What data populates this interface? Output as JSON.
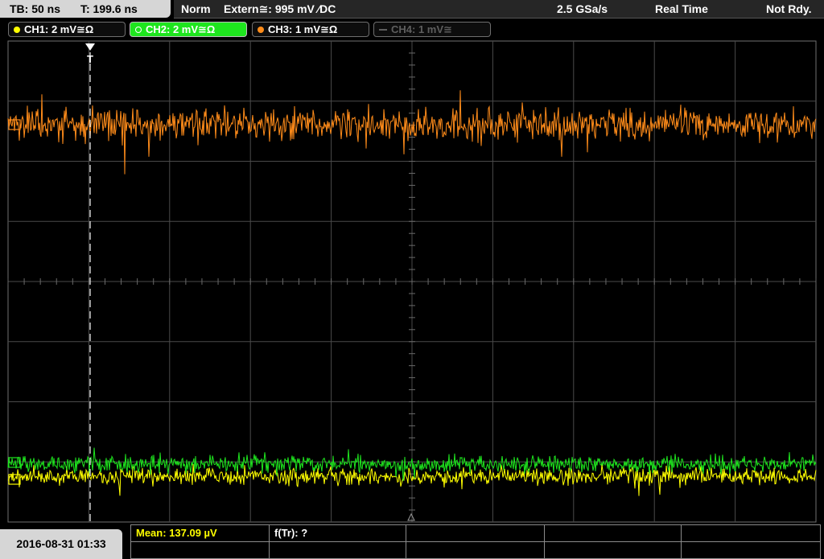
{
  "timebase": {
    "tb": "TB: 50 ns",
    "trigger_time": "T: 199.6 ns"
  },
  "status": {
    "mode": "Norm",
    "trigger": "Extern≅: 995 mV ∕DC",
    "sample_rate": "2.5 GSa/s",
    "acq_mode": "Real Time",
    "ready": "Not Rdy."
  },
  "channels": [
    {
      "label": "CH1: 2 mV≅Ω",
      "color": "#ffff00",
      "state": "on"
    },
    {
      "label": "CH2: 2 mV≅Ω",
      "color": "#1ee51e",
      "state": "active"
    },
    {
      "label": "CH3: 1 mV≅Ω",
      "color": "#ff8c1a",
      "state": "on"
    },
    {
      "label": "CH4: 1 mV≅",
      "color": "#5e5e5e",
      "state": "off"
    }
  ],
  "trigger_marker": "T",
  "measurements": {
    "mean": "Mean: 137.09 µV",
    "freq": "f(Tr): ?"
  },
  "datetime": "2016-08-31 01:33",
  "colors": {
    "ch1": "#ffff00",
    "ch2": "#1ee51e",
    "ch3": "#ff8c1a",
    "grid": "#4a4a4a",
    "trigger_line": "#ffffff"
  }
}
